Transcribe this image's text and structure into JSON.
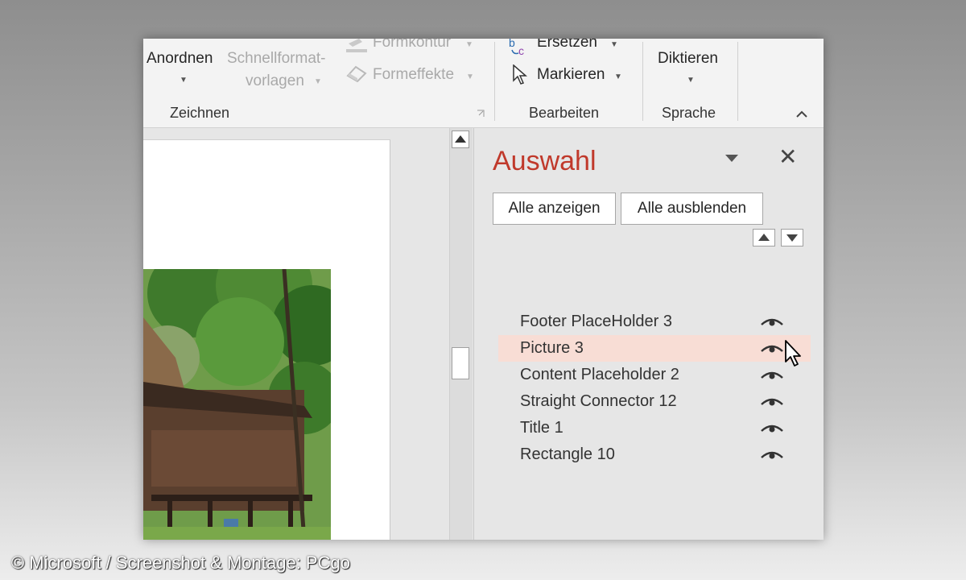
{
  "ribbon": {
    "anordnen": "Anordnen",
    "schnellformat_line1": "Schnellformat-",
    "schnellformat_line2": "vorlagen",
    "formkontur": "Formkontur",
    "formeffekte": "Formeffekte",
    "ersetzen": "Ersetzen",
    "markieren": "Markieren",
    "diktieren": "Diktieren",
    "groups": {
      "zeichnen": "Zeichnen",
      "bearbeiten": "Bearbeiten",
      "sprache": "Sprache"
    }
  },
  "selection_pane": {
    "title": "Auswahl",
    "show_all": "Alle anzeigen",
    "hide_all": "Alle ausblenden",
    "items": [
      {
        "label": "Footer PlaceHolder 3"
      },
      {
        "label": "Picture 3"
      },
      {
        "label": "Content Placeholder 2"
      },
      {
        "label": "Straight Connector 12"
      },
      {
        "label": "Title 1"
      },
      {
        "label": "Rectangle 10"
      }
    ],
    "selected_item": "Picture 3",
    "accent_color": "#c0392b",
    "highlight_color": "#f8ddd5"
  },
  "caption": "© Microsoft / Screenshot & Montage: PCgo",
  "icons": [
    "dropdown-caret-icon",
    "replace-icon",
    "select-cursor-icon",
    "shape-outline-icon",
    "shape-effects-icon",
    "eye-icon",
    "close-icon",
    "mouse-pointer-icon",
    "collapse-ribbon-icon"
  ]
}
